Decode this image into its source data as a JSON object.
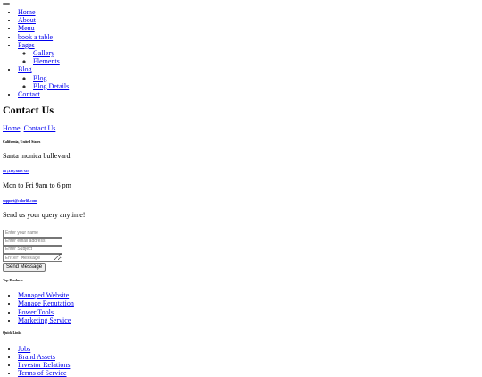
{
  "nav": {
    "items": [
      {
        "label": "Home"
      },
      {
        "label": "About"
      },
      {
        "label": "Menu"
      },
      {
        "label": "book a table"
      },
      {
        "label": "Pages"
      },
      {
        "label": "Gallery"
      },
      {
        "label": "Elements"
      },
      {
        "label": "Blog"
      },
      {
        "label": "Blog"
      },
      {
        "label": "Blog Details"
      },
      {
        "label": "Contact"
      }
    ]
  },
  "page": {
    "title": "Contact Us",
    "breadcrumb": [
      "Home",
      "Contact Us"
    ]
  },
  "contact": {
    "location_heading": "California, United States",
    "address": "Santa monica bullevard",
    "phone": "00 (440) 9865 562",
    "hours": "Mon to Fri 9am to 6 pm",
    "email": "support@colorlib.com",
    "email_note": "Send us your query anytime!"
  },
  "form": {
    "name_placeholder": "Enter your name",
    "email_placeholder": "Enter email address",
    "subject_placeholder": "Enter Subject",
    "message_placeholder": "Enter Message",
    "submit_label": "Send Message"
  },
  "footer": {
    "top_products_title": "Top Products",
    "top_products": [
      "Managed Website",
      "Manage Reputation",
      "Power Tools",
      "Marketing Service"
    ],
    "quick_links_title": "Quick Links",
    "quick_links": [
      "Jobs",
      "Brand Assets",
      "Investor Relations",
      "Terms of Service"
    ]
  }
}
